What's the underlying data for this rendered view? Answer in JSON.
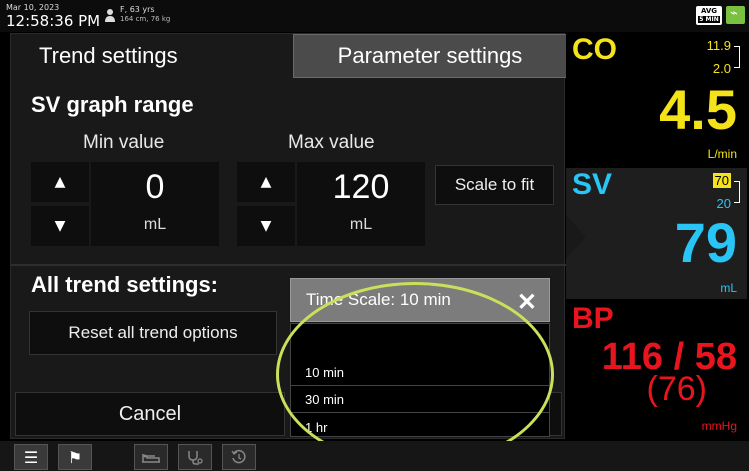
{
  "status_bar": {
    "date": "Mar 10, 2023",
    "time": "12:58:36 PM",
    "patient_line1": "F, 63 yrs",
    "patient_line2": "164 cm, 76 kg",
    "avg_badge": "AVG",
    "avg_interval": "5 MIN"
  },
  "tabs": {
    "trend": "Trend settings",
    "parameter": "Parameter settings"
  },
  "graph_range": {
    "title": "SV graph range",
    "min_label": "Min value",
    "max_label": "Max value",
    "min_value": "0",
    "max_value": "120",
    "unit": "mL",
    "scale_to_fit": "Scale to fit"
  },
  "all_trend": {
    "title": "All trend settings:",
    "reset_button": "Reset all trend options"
  },
  "time_scale": {
    "selected_label": "Time Scale: 10 min",
    "options": [
      "10 min",
      "30 min",
      "1 hr"
    ]
  },
  "cancel_button": "Cancel",
  "parameters": {
    "co": {
      "name": "CO",
      "upper": "11.9",
      "lower": "2.0",
      "value": "4.5",
      "unit": "L/min",
      "color": "#f5e31a"
    },
    "sv": {
      "name": "SV",
      "upper": "70",
      "lower": "20",
      "value": "79",
      "unit": "mL",
      "color": "#29c5f6"
    },
    "bp": {
      "name": "BP",
      "value": "116 / 58",
      "mean": "(76)",
      "unit": "mmHg",
      "color": "#e8141e"
    }
  },
  "toolbar": {
    "icons": [
      "menu-icon",
      "flag-icon",
      "patient-bed-icon",
      "stethoscope-icon",
      "history-icon"
    ]
  }
}
